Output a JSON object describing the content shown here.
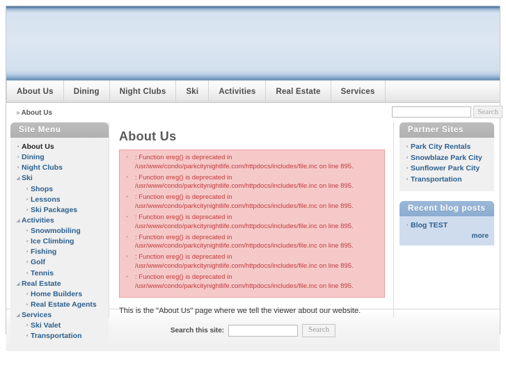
{
  "nav": {
    "items": [
      {
        "label": "About Us"
      },
      {
        "label": "Dining"
      },
      {
        "label": "Night Clubs"
      },
      {
        "label": "Ski"
      },
      {
        "label": "Activities"
      },
      {
        "label": "Real Estate"
      },
      {
        "label": "Services"
      }
    ]
  },
  "breadcrumb": {
    "marker": "»",
    "text": "About Us"
  },
  "top_search": {
    "value": "",
    "placeholder": "",
    "button_label": "Search"
  },
  "sidebar": {
    "title": "Site Menu",
    "items": [
      {
        "label": "About Us",
        "marker": "square",
        "level": 0,
        "active": true
      },
      {
        "label": "Dining",
        "marker": "square",
        "level": 0,
        "active": false
      },
      {
        "label": "Night Clubs",
        "marker": "square",
        "level": 0,
        "active": false
      },
      {
        "label": "Ski",
        "marker": "triangle",
        "level": 0,
        "active": false
      },
      {
        "label": "Shops",
        "marker": "square",
        "level": 1,
        "active": false
      },
      {
        "label": "Lessons",
        "marker": "square",
        "level": 1,
        "active": false
      },
      {
        "label": "Ski Packages",
        "marker": "square",
        "level": 1,
        "active": false
      },
      {
        "label": "Activities",
        "marker": "triangle",
        "level": 0,
        "active": false
      },
      {
        "label": "Snowmobiling",
        "marker": "square",
        "level": 1,
        "active": false
      },
      {
        "label": "Ice Climbing",
        "marker": "square",
        "level": 1,
        "active": false
      },
      {
        "label": "Fishing",
        "marker": "square",
        "level": 1,
        "active": false
      },
      {
        "label": "Golf",
        "marker": "square",
        "level": 1,
        "active": false
      },
      {
        "label": "Tennis",
        "marker": "square",
        "level": 1,
        "active": false
      },
      {
        "label": "Real Estate",
        "marker": "triangle",
        "level": 0,
        "active": false
      },
      {
        "label": "Home Builders",
        "marker": "square",
        "level": 1,
        "active": false
      },
      {
        "label": "Real Estate Agents",
        "marker": "square",
        "level": 1,
        "active": false
      },
      {
        "label": "Services",
        "marker": "triangle",
        "level": 0,
        "active": false
      },
      {
        "label": "Ski Valet",
        "marker": "square",
        "level": 1,
        "active": false
      },
      {
        "label": "Transportation",
        "marker": "square",
        "level": 1,
        "active": false
      }
    ]
  },
  "main": {
    "title": "About Us",
    "messages": [
      {
        "line1": ": Function ereg() is deprecated in",
        "line2": "/usr/www/condo/parkcitynightlife.com/httpdocs/includes/file.inc on line 895."
      },
      {
        "line1": ": Function ereg() is deprecated in",
        "line2": "/usr/www/condo/parkcitynightlife.com/httpdocs/includes/file.inc on line 895."
      },
      {
        "line1": ": Function ereg() is deprecated in",
        "line2": "/usr/www/condo/parkcitynightlife.com/httpdocs/includes/file.inc on line 895."
      },
      {
        "line1": ": Function ereg() is deprecated in",
        "line2": "/usr/www/condo/parkcitynightlife.com/httpdocs/includes/file.inc on line 895."
      },
      {
        "line1": ": Function ereg() is deprecated in",
        "line2": "/usr/www/condo/parkcitynightlife.com/httpdocs/includes/file.inc on line 895."
      },
      {
        "line1": ": Function ereg() is deprecated in",
        "line2": "/usr/www/condo/parkcitynightlife.com/httpdocs/includes/file.inc on line 895."
      },
      {
        "line1": ": Function ereg() is deprecated in",
        "line2": "/usr/www/condo/parkcitynightlife.com/httpdocs/includes/file.inc on line 895."
      }
    ],
    "body_text": "This is the \"About Us\" page where we tell the viewer about our website."
  },
  "partner_sites": {
    "title": "Partner Sites",
    "items": [
      {
        "label": "Park City Rentals"
      },
      {
        "label": "Snowblaze Park City"
      },
      {
        "label": "Sunflower Park City"
      },
      {
        "label": "Transportation"
      }
    ]
  },
  "recent_blog": {
    "title": "Recent blog posts",
    "items": [
      {
        "label": "Blog TEST"
      }
    ],
    "more_label": "more"
  },
  "footer_search": {
    "label": "Search this site:",
    "value": "",
    "placeholder": "",
    "button_label": "Search"
  },
  "colors": {
    "accent_blue": "#2c5f8e",
    "banner_blue": "#d6e2ef",
    "error_bg": "#f6c9c9",
    "error_text": "#c23b3b",
    "block_gray": "#b0b0b0",
    "block_blue": "#8bacd1"
  }
}
